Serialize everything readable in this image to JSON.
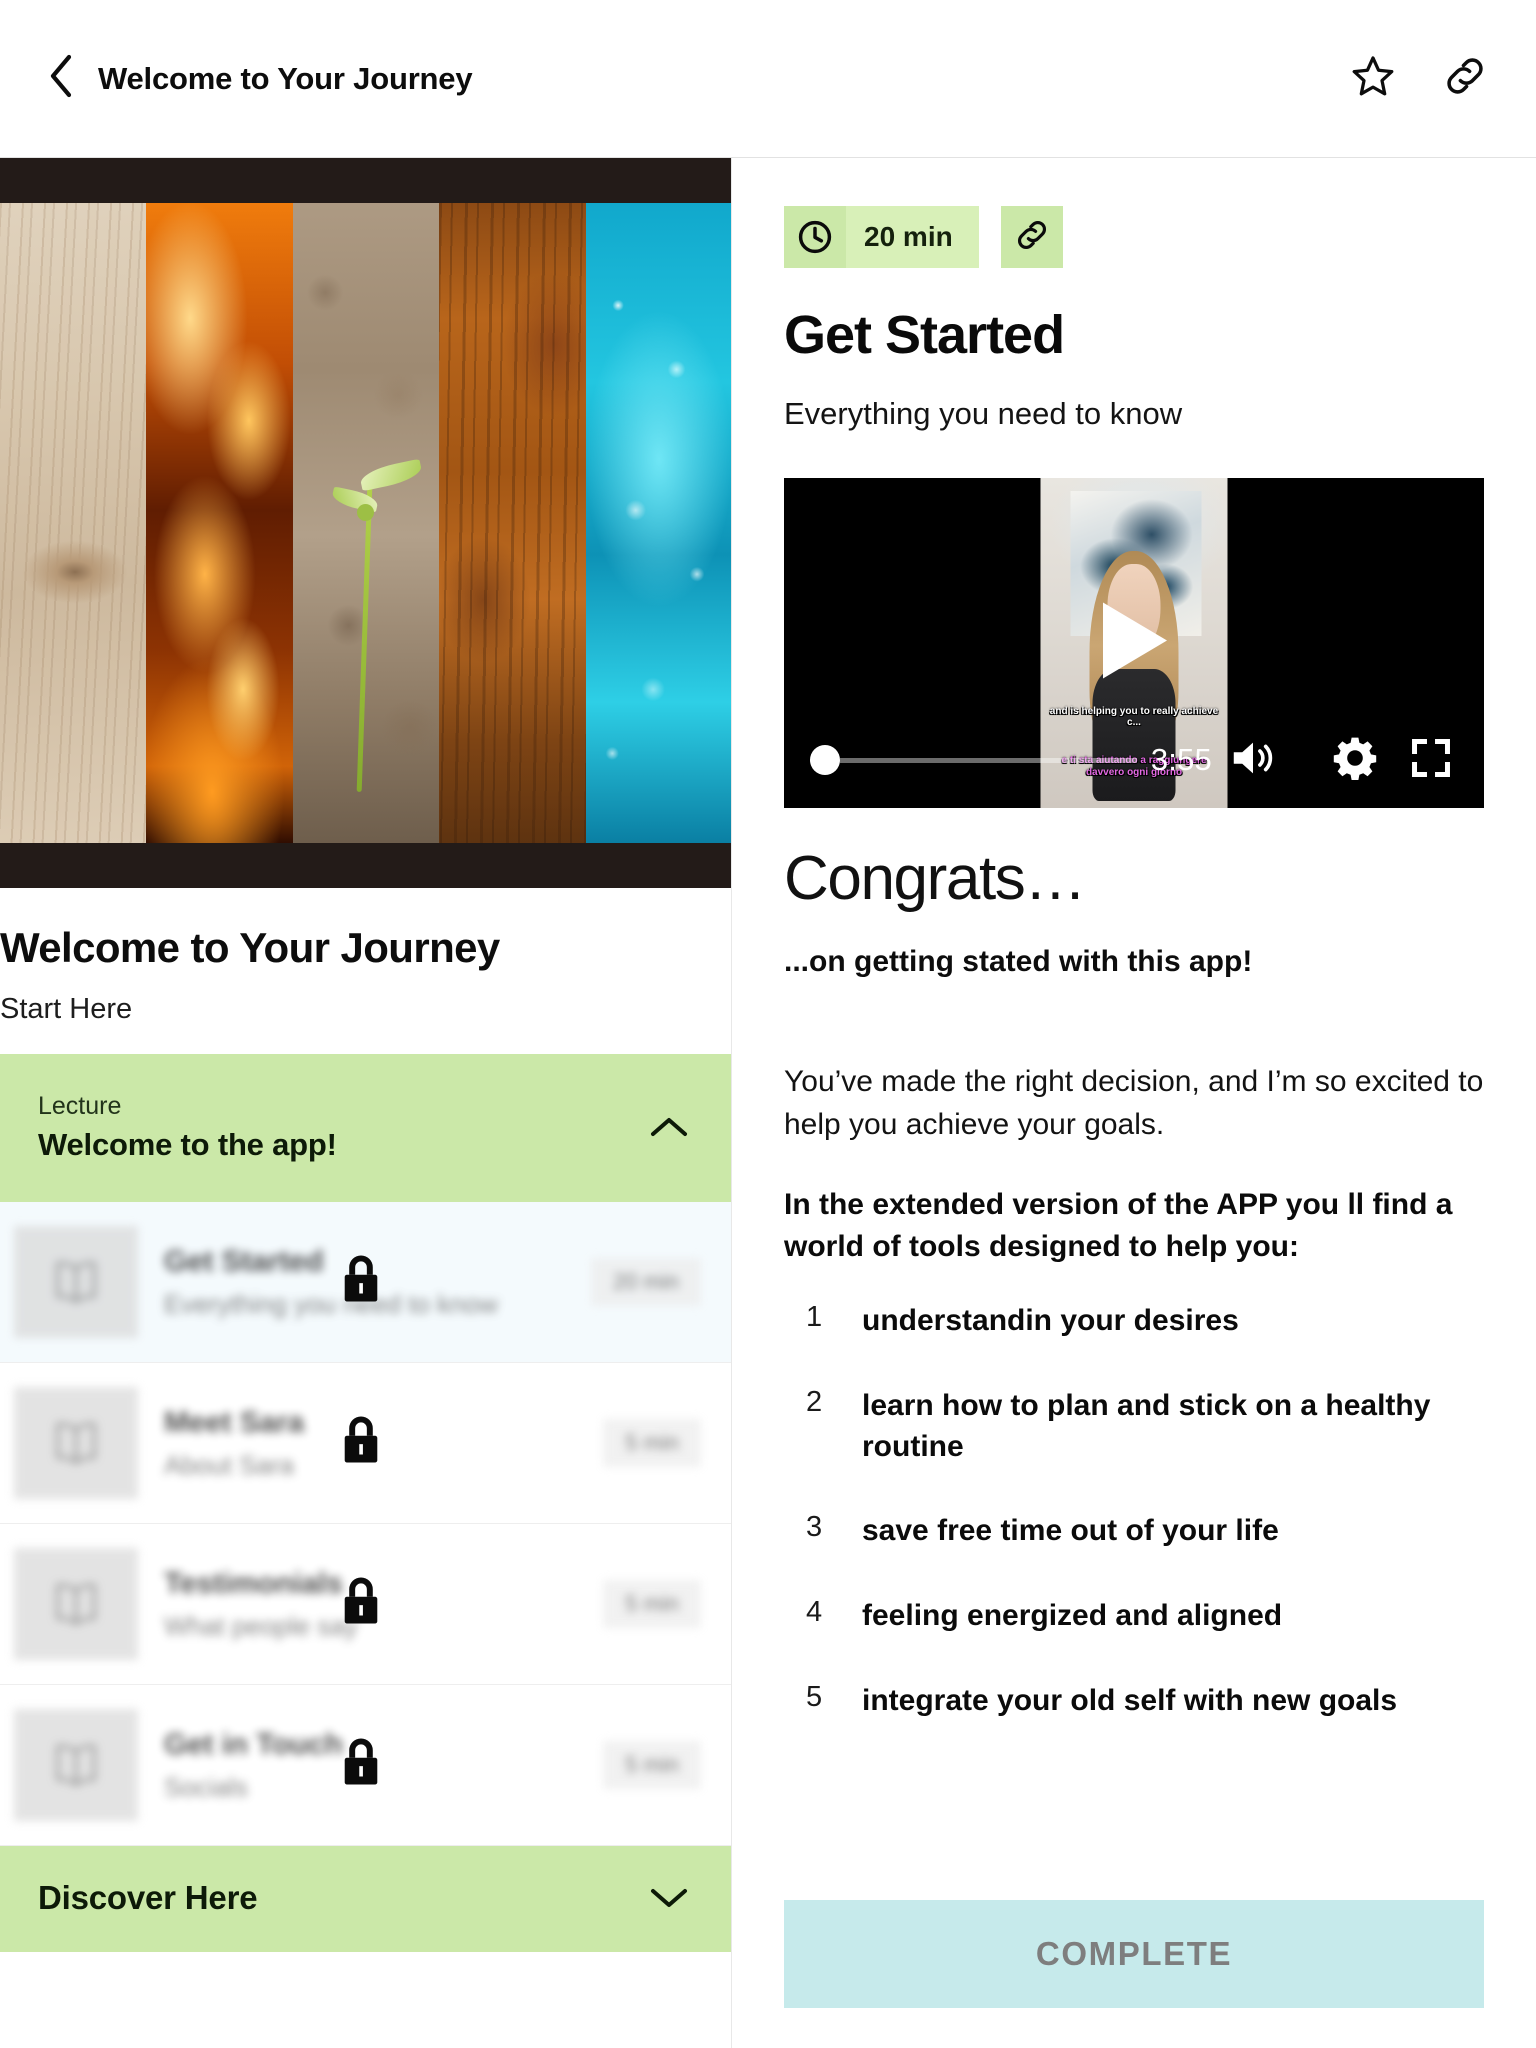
{
  "topbar": {
    "back_icon": "chevron-left-icon",
    "title": "Welcome to Your Journey",
    "star_icon": "star-outline-icon",
    "link_icon": "link-icon"
  },
  "left": {
    "hero_alt": "five-elements-banner",
    "hero_strips": [
      "wood",
      "fire",
      "earth",
      "metal",
      "water"
    ],
    "title": "Welcome to Your Journey",
    "subtitle": "Start Here",
    "section": {
      "kicker": "Lecture",
      "title": "Welcome to the app!",
      "chevron": "chevron-up-icon",
      "expanded": true
    },
    "lessons": [
      {
        "title": "Get Started",
        "subtitle": "Everything you need to know",
        "duration": "20 min",
        "locked": true,
        "active": true,
        "thumb_icon": "book-icon",
        "lock_icon": "lock-icon"
      },
      {
        "title": "Meet Sara",
        "subtitle": "About Sara",
        "duration": "5 min",
        "locked": true,
        "active": false,
        "thumb_icon": "book-icon",
        "lock_icon": "lock-icon"
      },
      {
        "title": "Testimonials",
        "subtitle": "What people say",
        "duration": "5 min",
        "locked": true,
        "active": false,
        "thumb_icon": "book-icon",
        "lock_icon": "lock-icon"
      },
      {
        "title": "Get in Touch",
        "subtitle": "Socials",
        "duration": "5 min",
        "locked": true,
        "active": false,
        "thumb_icon": "book-icon",
        "lock_icon": "lock-icon"
      }
    ],
    "section2": {
      "title": "Discover Here",
      "chevron": "chevron-down-icon",
      "expanded": false
    }
  },
  "right": {
    "badge_clock_icon": "clock-icon",
    "badge_duration": "20 min",
    "badge_link_icon": "link-icon",
    "title": "Get Started",
    "subtitle": "Everything you need to know",
    "video": {
      "play_icon": "play-icon",
      "time": "3:55",
      "volume_icon": "volume-icon",
      "settings_icon": "gear-icon",
      "fullscreen_icon": "fullscreen-icon",
      "progress_percent": 0,
      "subtitle_en": "and is helping you to really achieve c...",
      "subtitle_it": "e ti sta aiutando a raggiungere davvero ogni giorno"
    },
    "heading": "Congrats…",
    "subheading": "...on getting stated with this app!",
    "paragraph": "You’ve made the right decision, and I’m so excited to help you achieve your goals.",
    "lead": "In the extended version of the APP you ll find a world of tools designed to help you:",
    "list": [
      {
        "index": "1",
        "text": "understandin your desires"
      },
      {
        "index": "2",
        "text": "learn how to plan and stick on a healthy routine"
      },
      {
        "index": "3",
        "text": "save free time out of your life"
      },
      {
        "index": "4",
        "text": "feeling energized and aligned"
      },
      {
        "index": "5",
        "text": "integrate your old self with new goals"
      }
    ],
    "complete_label": "COMPLETE"
  },
  "colors": {
    "accent_green": "#cbe8a8",
    "badge_green_light": "#d8f0b8",
    "complete_teal": "#c6eaeb",
    "active_row": "#f4fafd"
  }
}
